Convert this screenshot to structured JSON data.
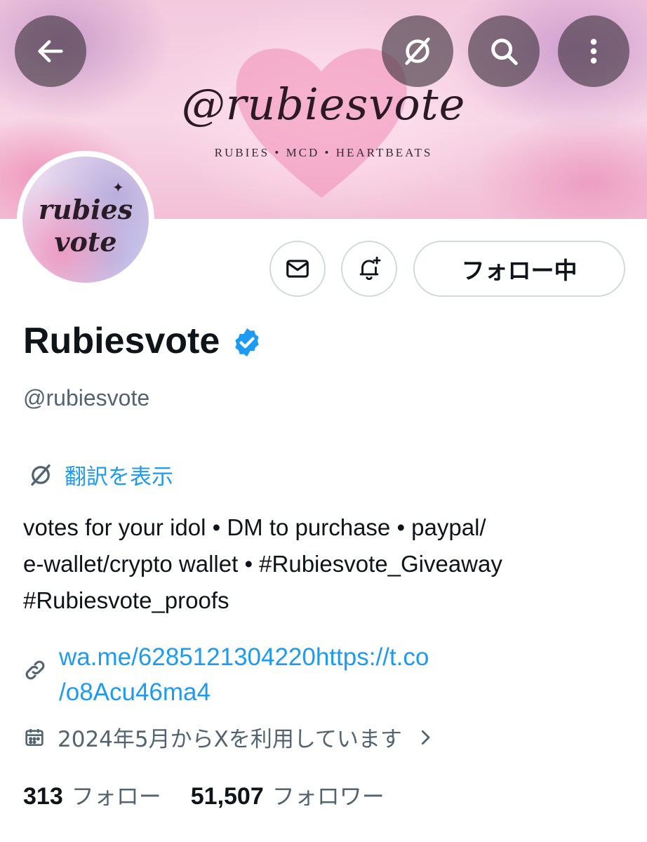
{
  "banner": {
    "title": "@rubiesvote",
    "subtitle": "RUBIES • MCD • HEARTBEATS"
  },
  "top_bar": {
    "back_icon": "arrow-left-icon",
    "grok_icon": "grok-icon",
    "search_icon": "search-icon",
    "more_icon": "more-vertical-icon"
  },
  "avatar": {
    "line1": "rubies",
    "line2": "vote",
    "sparkle": "✦"
  },
  "actions": {
    "message_icon": "envelope-icon",
    "notify_icon": "bell-plus-icon",
    "follow_label": "フォロー中"
  },
  "profile": {
    "display_name": "Rubiesvote",
    "handle": "@rubiesvote",
    "translate_label": "翻訳を表示",
    "bio_lines": [
      "votes for your idol • DM to purchase • paypal/",
      "e-wallet/crypto wallet • #Rubiesvote_Giveaway",
      "#Rubiesvote_proofs"
    ],
    "link_lines": [
      "wa.me/6285121304220https://t.co",
      "/o8Acu46ma4"
    ],
    "joined": "2024年5月からXを利用しています"
  },
  "stats": {
    "following_count": "313",
    "following_label": "フォロー",
    "followers_count": "51,507",
    "followers_label": "フォロワー"
  },
  "colors": {
    "accent": "#1d9bf0",
    "secondary_text": "#536471",
    "border": "#cfd9de"
  }
}
